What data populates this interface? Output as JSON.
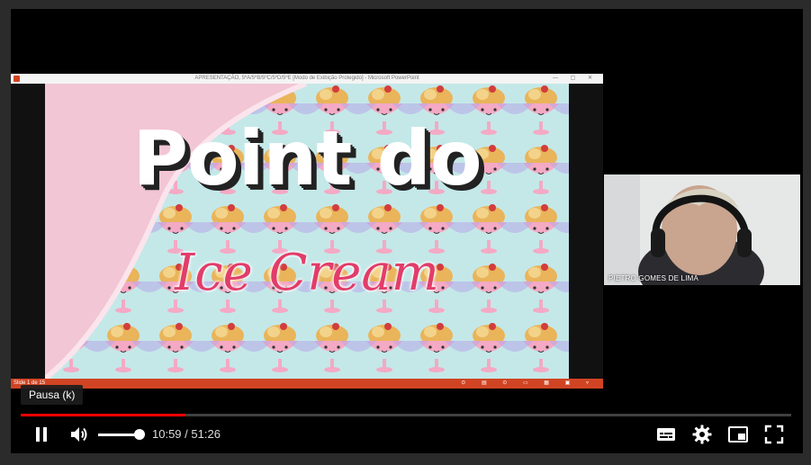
{
  "player": {
    "tooltip": "Pausa (k)",
    "current_time": "10:59",
    "separator": " / ",
    "duration": "51:26",
    "progress_fraction": 0.214,
    "volume_fraction": 1.0,
    "accent_color": "#ff0000"
  },
  "presentation": {
    "window_title": "APRESENTAÇÃO, 5ºA/5ºB/5ºC/5ºD/5ºE [Modo de Exibição Protegido] - Microsoft PowerPoint",
    "window_buttons": "— ▢ ✕",
    "slide_title": "Point do",
    "slide_subtitle": "Ice Cream",
    "status_left": "Slide 1 de 15",
    "status_right": "⊙ ▤ ⊙ ▭ ▦ ▣ ▿",
    "app_color": "#d04423"
  },
  "participant": {
    "name": "PIETRO GOMES DE LIMA"
  },
  "icons": {
    "play_pause": "pause-icon",
    "volume": "volume-icon",
    "subtitles": "subtitles-icon",
    "settings": "gear-icon",
    "miniplayer": "miniplayer-icon",
    "fullscreen": "fullscreen-icon"
  }
}
